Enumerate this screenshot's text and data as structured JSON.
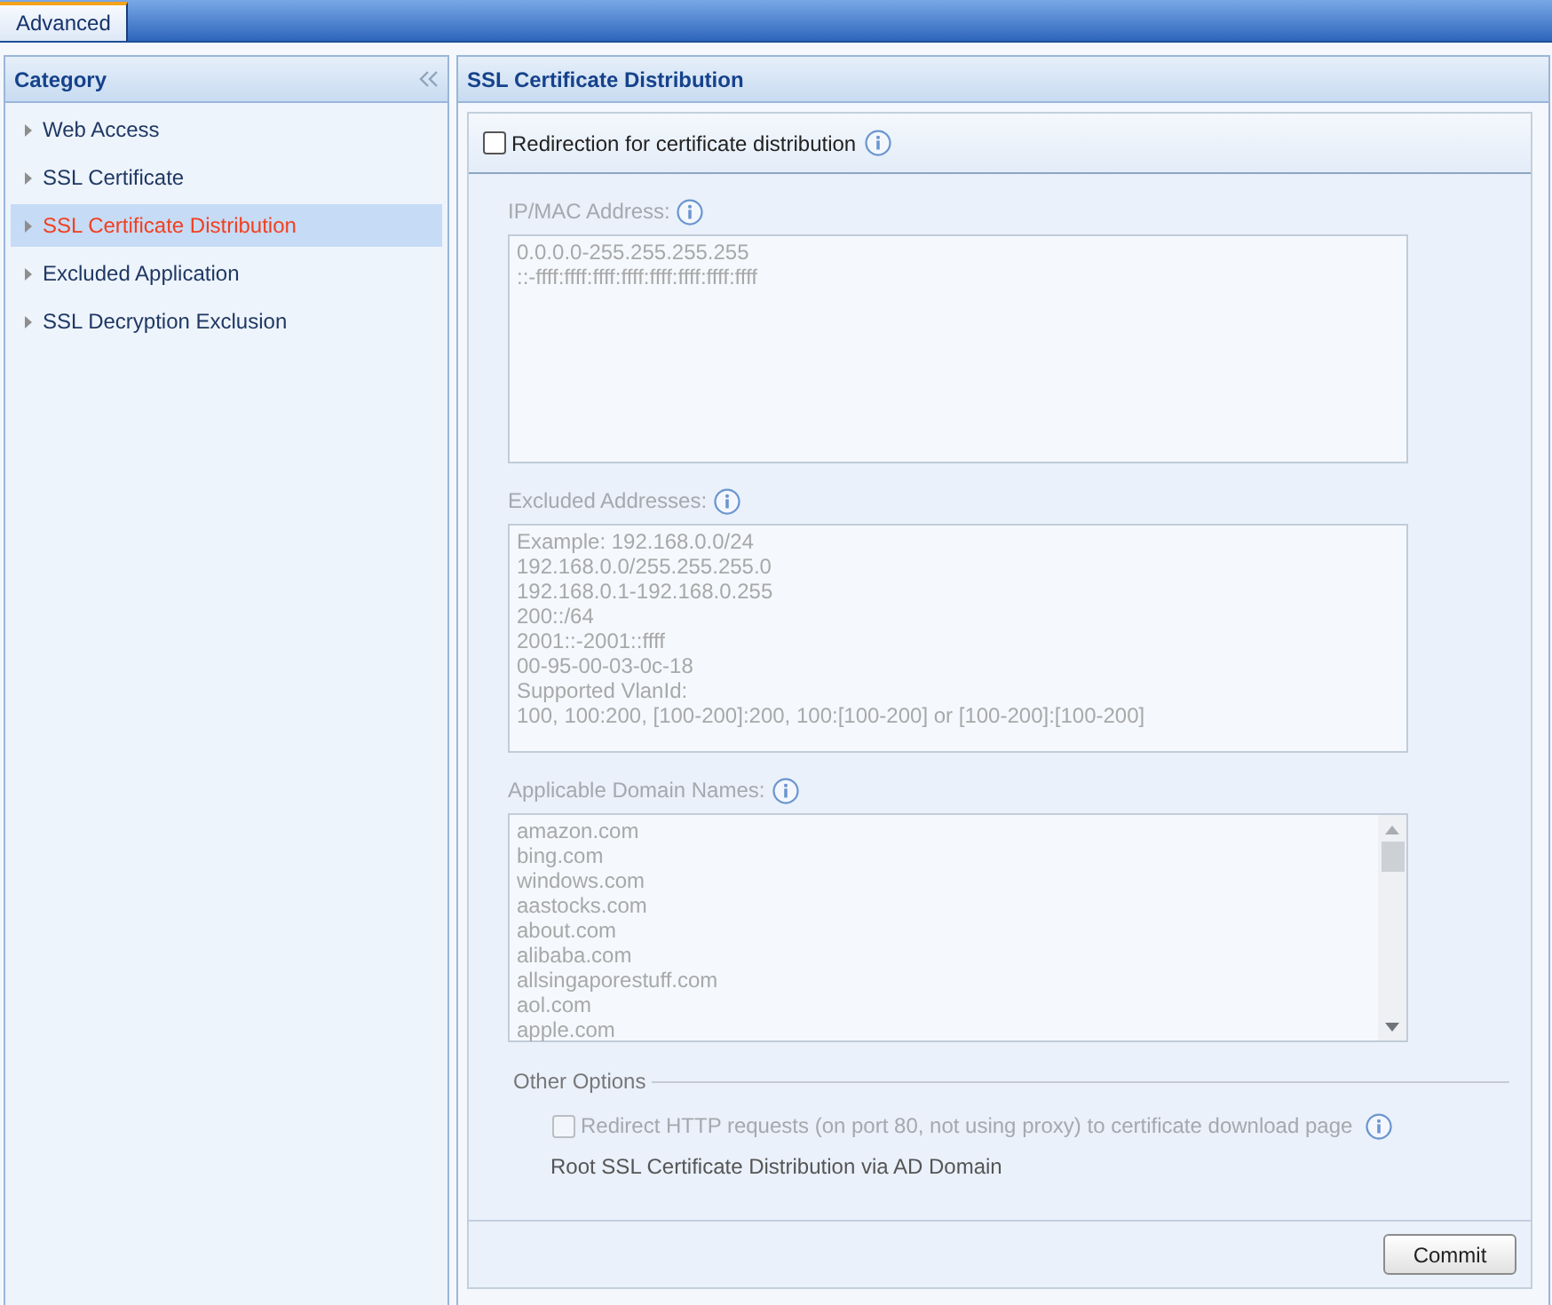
{
  "tabs": [
    {
      "label": "Advanced",
      "selected": true
    }
  ],
  "sidebar": {
    "title": "Category",
    "items": [
      {
        "label": "Web Access",
        "selected": false
      },
      {
        "label": "SSL Certificate",
        "selected": false
      },
      {
        "label": "SSL Certificate Distribution",
        "selected": true
      },
      {
        "label": "Excluded Application",
        "selected": false
      },
      {
        "label": "SSL Decryption Exclusion",
        "selected": false
      }
    ]
  },
  "main": {
    "title": "SSL Certificate Distribution",
    "redirection": {
      "label": "Redirection for certificate distribution",
      "checked": false
    },
    "fields": [
      {
        "kind": "textarea",
        "label": "IP/MAC Address:",
        "placeholder": "0.0.0.0-255.255.255.255\n::-ffff:ffff:ffff:ffff:ffff:ffff:ffff:ffff",
        "disabled": true
      },
      {
        "kind": "textarea",
        "label": "Excluded Addresses:",
        "placeholder": "Example: 192.168.0.0/24\n192.168.0.0/255.255.255.0\n192.168.0.1-192.168.0.255\n200::/64\n2001::-2001::ffff\n00-95-00-03-0c-18\nSupported VlanId:\n100, 100:200, [100-200]:200, 100:[100-200] or [100-200]:[100-200]",
        "disabled": true
      },
      {
        "kind": "list",
        "label": "Applicable Domain Names:",
        "items": [
          "amazon.com",
          "bing.com",
          "windows.com",
          "aastocks.com",
          "about.com",
          "alibaba.com",
          "allsingaporestuff.com",
          "aol.com",
          "apple.com"
        ],
        "disabled": true
      }
    ],
    "other_options": {
      "title": "Other Options",
      "options": [
        {
          "kind": "checkbox",
          "label": "Redirect HTTP requests (on port 80, not using proxy) to certificate download page",
          "checked": false,
          "disabled": true
        },
        {
          "kind": "text",
          "label": "Root SSL Certificate Distribution via AD Domain"
        }
      ]
    },
    "commit_button": "Commit"
  }
}
